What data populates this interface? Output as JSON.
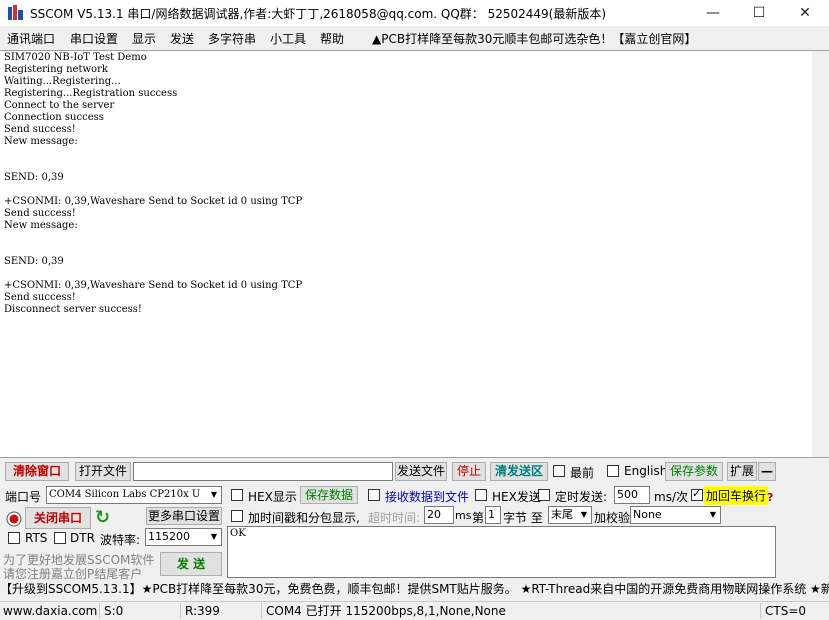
{
  "window": {
    "title": "SSCOM V5.13.1 串口/网络数据调试器,作者:大虾丁丁,2618058@qq.com. QQ群： 52502449(最新版本)",
    "minimize_glyph": "—",
    "maximize_glyph": "☐",
    "close_glyph": "✕"
  },
  "menu": {
    "items": [
      "通讯端口",
      "串口设置",
      "显示",
      "发送",
      "多字符串",
      "小工具",
      "帮助"
    ],
    "promo": "▲PCB打样降至每款30元顺丰包邮可选杂色！【嘉立创官网】"
  },
  "terminal": {
    "text": "SIM7020 NB-IoT Test Demo\nRegistering network\nWaiting...Registering...\nRegistering...Registration success\nConnect to the server\nConnection success\nSend success!\nNew message:\n\n\nSEND: 0,39\n\n+CSONMI: 0,39,Waveshare Send to Socket id 0 using TCP\nSend success!\nNew message:\n\n\nSEND: 0,39\n\n+CSONMI: 0,39,Waveshare Send to Socket id 0 using TCP\nSend success!\nDisconnect server success!"
  },
  "toolbar1": {
    "clear_window": "清除窗口",
    "open_file": "打开文件",
    "file_path": "",
    "send_file": "发送文件",
    "stop": "停止",
    "clear_send_area": "清发送区",
    "topmost": "最前",
    "english": "English",
    "save_params": "保存参数",
    "expand": "扩展",
    "collapse": "—"
  },
  "port": {
    "port_label": "端口号",
    "port_value": "COM4 Silicon Labs CP210x U",
    "close_port": "关闭串口",
    "more_settings": "更多串口设置",
    "rts": "RTS",
    "dtr": "DTR",
    "baud_label": "波特率:",
    "baud_value": "115200",
    "promo_line1": "为了更好地发展SSCOM软件",
    "promo_line2": "请您注册嘉立创P结尾客户",
    "send_button": "发 送"
  },
  "options": {
    "hex_display": "HEX显示",
    "save_data": "保存数据",
    "receive_to_file": "接收数据到文件",
    "hex_send": "HEX发送",
    "timed_send": "定时发送:",
    "interval_value": "500",
    "interval_unit": "ms/次",
    "append_crlf": "加回车换行",
    "timestamp": "加时间戳和分包显示,",
    "timeout_label": "超时时间:",
    "timeout_value": "20",
    "timeout_unit": "ms",
    "byte_prefix": "第",
    "byte_value": "1",
    "byte_label": "字节 至",
    "end_value": "末尾",
    "checksum_label": "加校验",
    "checksum_value": "None",
    "help_mark": "?"
  },
  "send_area": {
    "text": "OK"
  },
  "ticker": {
    "text": "【升级到SSCOM5.13.1】★PCB打样降至每款30元，免费色费，顺丰包邮！提供SMT贴片服务。 ★RT-Thread来自中国的开源免费商用物联网操作系统 ★新一代"
  },
  "status": {
    "website": "www.daxia.com",
    "sent": "S:0",
    "received": "R:399",
    "port_status": "COM4 已打开  115200bps,8,1,None,None",
    "cts": "CTS=0"
  },
  "colors": {
    "accent_red": "#c00000",
    "accent_green": "#008000",
    "highlight_yellow": "#ffff00"
  }
}
